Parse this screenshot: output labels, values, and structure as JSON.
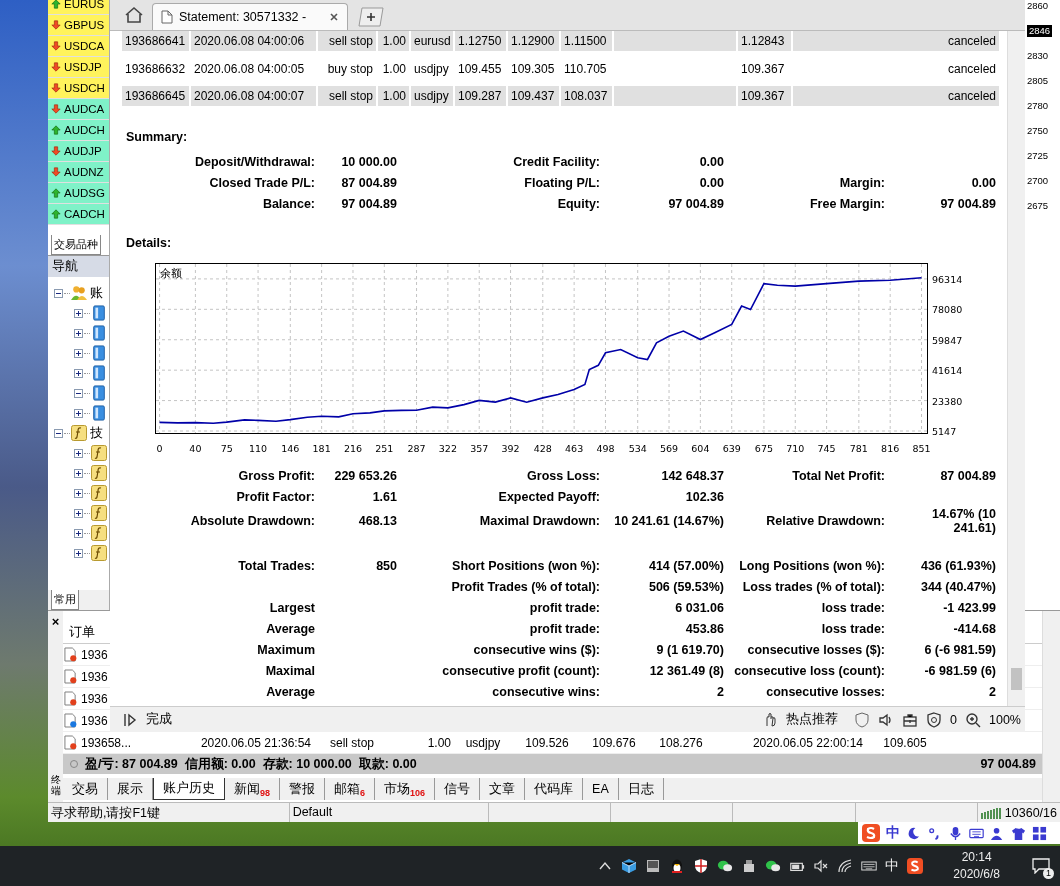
{
  "market_watch": {
    "symbols": [
      {
        "label": "EURUS",
        "kind": "up",
        "color": "#fff35c"
      },
      {
        "label": "GBPUS",
        "kind": "down",
        "color": "#fff35c"
      },
      {
        "label": "USDCA",
        "kind": "down",
        "color": "#fff35c"
      },
      {
        "label": "USDJP",
        "kind": "down",
        "color": "#fff35c"
      },
      {
        "label": "USDCH",
        "kind": "down",
        "color": "#fff35c"
      },
      {
        "label": "AUDCA",
        "kind": "down",
        "color": "#7ff2c8"
      },
      {
        "label": "AUDCH",
        "kind": "up",
        "color": "#7ff2c8"
      },
      {
        "label": "AUDJP",
        "kind": "down",
        "color": "#7ff2c8"
      },
      {
        "label": "AUDNZ",
        "kind": "down",
        "color": "#7ff2c8"
      },
      {
        "label": "AUDSG",
        "kind": "up",
        "color": "#7ff2c8"
      },
      {
        "label": "CADCH",
        "kind": "up",
        "color": "#7ff2c8"
      }
    ],
    "tab": "交易品种"
  },
  "navigator": {
    "title": "导航",
    "tree": [
      {
        "label": "账",
        "kind": "accounts",
        "expanded": true,
        "children": [
          {
            "kind": "server",
            "expanded": false
          },
          {
            "kind": "server",
            "expanded": false
          },
          {
            "kind": "server",
            "expanded": false
          },
          {
            "kind": "server",
            "expanded": false
          },
          {
            "kind": "server",
            "expanded": true
          },
          {
            "kind": "server",
            "expanded": false
          }
        ]
      },
      {
        "label": "技",
        "kind": "indicators",
        "expanded": true,
        "children": [
          {
            "kind": "indicator",
            "expanded": false
          },
          {
            "kind": "indicator",
            "expanded": false
          },
          {
            "kind": "indicator",
            "expanded": false
          },
          {
            "kind": "indicator",
            "expanded": false
          },
          {
            "kind": "indicator",
            "expanded": false
          },
          {
            "kind": "indicator",
            "expanded": false
          }
        ]
      }
    ],
    "tab": "常用"
  },
  "price_scale": [
    {
      "label": "2860",
      "current": false
    },
    {
      "label": "2846",
      "current": true
    },
    {
      "label": "2830",
      "current": false
    },
    {
      "label": "2805",
      "current": false
    },
    {
      "label": "2780",
      "current": false
    },
    {
      "label": "2750",
      "current": false
    },
    {
      "label": "2725",
      "current": false
    },
    {
      "label": "2700",
      "current": false
    },
    {
      "label": "2675",
      "current": false
    }
  ],
  "browser": {
    "tabs": [
      {
        "title": "Statement: 30571332 -",
        "selected": true
      }
    ],
    "orders_table": {
      "rows": [
        [
          "193686641",
          "2020.06.08 04:00:06",
          "sell stop",
          "1.00",
          "eurusd",
          "1.12750",
          "1.12900",
          "1.11500",
          "1.12843",
          "canceled"
        ],
        [
          "193686632",
          "2020.06.08 04:00:05",
          "buy stop",
          "1.00",
          "usdjpy",
          "109.455",
          "109.305",
          "110.705",
          "109.367",
          "canceled"
        ],
        [
          "193686645",
          "2020.06.08 04:00:07",
          "sell stop",
          "1.00",
          "usdjpy",
          "109.287",
          "109.437",
          "108.037",
          "109.367",
          "canceled"
        ]
      ]
    },
    "summary": {
      "heading": "Summary:",
      "rows": [
        {
          "left": {
            "label": "Deposit/Withdrawal:",
            "value": "10 000.00"
          },
          "middle": {
            "label": "Credit Facility:",
            "value": "0.00"
          }
        },
        {
          "left": {
            "label": "Closed Trade P/L:",
            "value": "87 004.89"
          },
          "middle": {
            "label": "Floating P/L:",
            "value": "0.00"
          },
          "right": {
            "label": "Margin:",
            "value": "0.00"
          }
        },
        {
          "left": {
            "label": "Balance:",
            "value": "97 004.89"
          },
          "middle": {
            "label": "Equity:",
            "value": "97 004.89"
          },
          "right": {
            "label": "Free Margin:",
            "value": "97 004.89"
          }
        }
      ]
    },
    "details": {
      "heading": "Details:",
      "chart_data": {
        "type": "line",
        "title": "余额",
        "x": [
          0,
          20,
          40,
          60,
          75,
          95,
          110,
          130,
          146,
          165,
          181,
          200,
          216,
          235,
          251,
          270,
          287,
          305,
          322,
          340,
          357,
          375,
          392,
          410,
          428,
          445,
          463,
          475,
          480,
          490,
          498,
          515,
          534,
          545,
          555,
          569,
          585,
          604,
          620,
          639,
          650,
          660,
          675,
          690,
          710,
          745,
          781,
          816,
          851
        ],
        "series": [
          {
            "color": "#0000a8",
            "values": [
              10300,
              10000,
              10200,
              9800,
              10500,
              11800,
              11500,
              11000,
              12000,
              13400,
              14000,
              13600,
              15500,
              16000,
              17200,
              17500,
              17600,
              19500,
              19000,
              21000,
              23500,
              22500,
              25000,
              22400,
              25000,
              27000,
              30000,
              33000,
              42000,
              44500,
              52000,
              54000,
              49000,
              48000,
              58000,
              62000,
              65000,
              60000,
              64000,
              69000,
              80000,
              78000,
              93500,
              92500,
              92000,
              93500,
              95000,
              95500,
              97000
            ]
          }
        ],
        "xticks": [
          0,
          40,
          75,
          110,
          146,
          181,
          216,
          251,
          287,
          322,
          357,
          392,
          428,
          463,
          498,
          534,
          569,
          604,
          639,
          675,
          710,
          745,
          781,
          816,
          851
        ],
        "yticks": [
          5147,
          23380,
          41614,
          59847,
          78080,
          96314
        ],
        "xlim": [
          -4,
          856
        ],
        "ylim": [
          5147,
          105250
        ],
        "grid": true
      },
      "stats": [
        [
          {
            "left": {
              "label": "Gross Profit:",
              "value": "229 653.26"
            },
            "middle": {
              "label": "Gross Loss:",
              "value": "142 648.37"
            },
            "right": {
              "label": "Total Net Profit:",
              "value": "87 004.89"
            }
          },
          {
            "left": {
              "label": "Profit Factor:",
              "value": "1.61"
            },
            "middle": {
              "label": "Expected Payoff:",
              "value": "102.36"
            }
          },
          {
            "left": {
              "label": "Absolute Drawdown:",
              "value": "468.13"
            },
            "middle": {
              "label": "Maximal Drawdown:",
              "value": "10 241.61 (14.67%)"
            },
            "right": {
              "label": "Relative Drawdown:",
              "value": "14.67% (10 241.61)"
            }
          }
        ],
        [
          {
            "left": {
              "label": "Total Trades:",
              "value": "850"
            },
            "middle": {
              "label": "Short Positions (won %):",
              "value": "414 (57.00%)"
            },
            "right": {
              "label": "Long Positions (won %):",
              "value": "436 (61.93%)"
            }
          },
          {
            "middle": {
              "label": "Profit Trades (% of total):",
              "value": "506 (59.53%)"
            },
            "right": {
              "label": "Loss trades (% of total):",
              "value": "344 (40.47%)"
            }
          },
          {
            "left": {
              "label": "Largest"
            },
            "middle": {
              "label": "profit trade:",
              "value": "6 031.06"
            },
            "right": {
              "label": "loss trade:",
              "value": "-1 423.99"
            }
          },
          {
            "left": {
              "label": "Average"
            },
            "middle": {
              "label": "profit trade:",
              "value": "453.86"
            },
            "right": {
              "label": "loss trade:",
              "value": "-414.68"
            }
          },
          {
            "left": {
              "label": "Maximum"
            },
            "middle": {
              "label": "consecutive wins ($):",
              "value": "9 (1 619.70)"
            },
            "right": {
              "label": "consecutive losses ($):",
              "value": "6 (-6 981.59)"
            }
          },
          {
            "left": {
              "label": "Maximal"
            },
            "middle": {
              "label": "consecutive profit (count):",
              "value": "12 361.49 (8)"
            },
            "right": {
              "label": "consecutive loss (count):",
              "value": "-6 981.59 (6)"
            }
          },
          {
            "left": {
              "label": "Average"
            },
            "middle": {
              "label": "consecutive wins:",
              "value": "2"
            },
            "right": {
              "label": "consecutive losses:",
              "value": "2"
            }
          }
        ]
      ]
    },
    "status_bar": {
      "text": "完成",
      "recommend": "热点推荐",
      "ad_count": "0",
      "zoom": "100%"
    }
  },
  "terminal": {
    "close": "×",
    "side_label": "终端",
    "column": "订单",
    "rows": [
      {
        "color": "#e2401c",
        "cells": [
          "1936"
        ]
      },
      {
        "color": "#e2401c",
        "cells": [
          "1936"
        ]
      },
      {
        "color": "#e2401c",
        "cells": [
          "1936"
        ]
      },
      {
        "color": "#1a78e0",
        "cells": [
          "1936"
        ]
      },
      {
        "color": "#e2401c",
        "cells": [
          "193658...",
          "2020.06.05 21:36:54",
          "sell stop",
          "1.00",
          "usdjpy",
          "109.526",
          "109.676",
          "108.276",
          "2020.06.05 22:00:14",
          "109.605"
        ]
      }
    ],
    "totals": {
      "text": "盈/亏: 87 004.89  信用额: 0.00  存款: 10 000.00  取款: 0.00",
      "balance": "97 004.89"
    },
    "tabs": [
      {
        "label": "交易",
        "selected": false
      },
      {
        "label": "展示",
        "selected": false
      },
      {
        "label": "账户历史",
        "selected": true
      },
      {
        "label": "新闻",
        "badge": "98",
        "selected": false
      },
      {
        "label": "警报",
        "selected": false
      },
      {
        "label": "邮箱",
        "badge": "6",
        "selected": false
      },
      {
        "label": "市场",
        "badge": "106",
        "selected": false
      },
      {
        "label": "信号",
        "selected": false
      },
      {
        "label": "文章",
        "selected": false
      },
      {
        "label": "代码库",
        "selected": false
      },
      {
        "label": "EA",
        "selected": false
      },
      {
        "label": "日志",
        "selected": false
      }
    ]
  },
  "status_bar": {
    "help": "寻求帮助,请按F1键",
    "profile": "Default",
    "traffic": "10360/16"
  },
  "ime_bar": {
    "mode": "中"
  },
  "taskbar": {
    "input_mode": "中",
    "time": "20:14",
    "date": "2020/6/8",
    "notifications": "1"
  }
}
